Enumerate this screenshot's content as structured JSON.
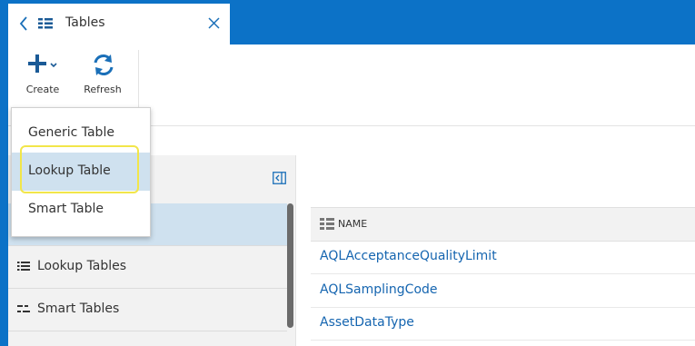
{
  "header": {
    "title": "Tables",
    "back_icon": "chevron-left-icon",
    "tables_icon": "grid-list-icon",
    "close_icon": "close-icon"
  },
  "toolbar": {
    "create_label": "Create",
    "refresh_label": "Refresh",
    "create_icon": "plus-icon",
    "refresh_icon": "refresh-icon"
  },
  "create_menu": {
    "items": [
      {
        "label": "Generic Table"
      },
      {
        "label": "Lookup Table",
        "active": true
      },
      {
        "label": "Smart Table"
      }
    ]
  },
  "sidebar": {
    "items": [
      {
        "label": "",
        "icon": "grid-list-icon",
        "selected": true
      },
      {
        "label": "Lookup Tables",
        "icon": "list-icon"
      },
      {
        "label": "Smart Tables",
        "icon": "smart-list-icon"
      }
    ]
  },
  "table": {
    "column_header": "NAME",
    "rows": [
      "AQLAcceptanceQualityLimit",
      "AQLSamplingCode",
      "AssetDataType"
    ]
  },
  "colors": {
    "brand_blue": "#0c72c7",
    "selection": "#cfe1ef",
    "link": "#1565b0",
    "highlight": "#f2e64a"
  }
}
